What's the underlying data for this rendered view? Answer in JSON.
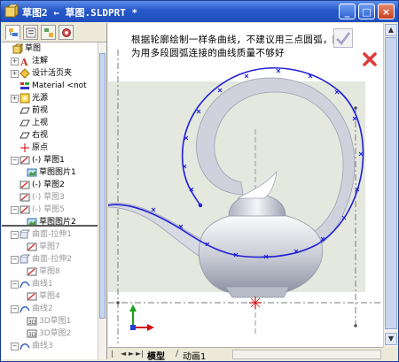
{
  "window": {
    "title": "草图2 ← 草图.SLDPRT *",
    "buttons": {
      "minimize": "_",
      "maximize": "□",
      "close": "×"
    }
  },
  "feature_tree": {
    "tabs": [
      "feature-manager",
      "property-manager",
      "configuration-manager",
      "display-manager"
    ],
    "items": [
      {
        "label": "草图",
        "icon": "part-icon",
        "indent": 0,
        "expander": "",
        "dim": false
      },
      {
        "label": "注解",
        "icon": "annotations-icon",
        "indent": 1,
        "expander": "+",
        "dim": false
      },
      {
        "label": "设计活页夹",
        "icon": "design-binder-icon",
        "indent": 1,
        "expander": "+",
        "dim": false
      },
      {
        "label": "Material <not",
        "icon": "material-icon",
        "indent": 1,
        "expander": "",
        "dim": false
      },
      {
        "label": "光源",
        "icon": "lights-icon",
        "indent": 1,
        "expander": "+",
        "dim": false
      },
      {
        "label": "前视",
        "icon": "plane-icon",
        "indent": 1,
        "expander": "",
        "dim": false
      },
      {
        "label": "上视",
        "icon": "plane-icon",
        "indent": 1,
        "expander": "",
        "dim": false
      },
      {
        "label": "右视",
        "icon": "plane-icon",
        "indent": 1,
        "expander": "",
        "dim": false
      },
      {
        "label": "原点",
        "icon": "origin-icon",
        "indent": 1,
        "expander": "",
        "dim": false
      },
      {
        "label": "(-) 草图1",
        "icon": "sketch-icon",
        "indent": 1,
        "expander": "−",
        "dim": false
      },
      {
        "label": "草图图片1",
        "icon": "sketch-picture-icon",
        "indent": 2,
        "expander": "",
        "dim": false
      },
      {
        "label": "(-) 草图2",
        "icon": "sketch-icon",
        "indent": 1,
        "expander": "",
        "dim": false
      },
      {
        "label": "(-) 草图3",
        "icon": "sketch-icon",
        "indent": 1,
        "expander": "",
        "dim": true
      },
      {
        "label": "(-) 草图5",
        "icon": "sketch-icon",
        "indent": 1,
        "expander": "−",
        "dim": true
      },
      {
        "label": "草图图片2",
        "icon": "sketch-picture-icon",
        "indent": 2,
        "expander": "",
        "dim": false
      },
      {
        "label": "曲面-拉伸1",
        "icon": "surface-extrude-icon",
        "indent": 1,
        "expander": "−",
        "dim": true
      },
      {
        "label": "草图7",
        "icon": "sketch-icon",
        "indent": 2,
        "expander": "",
        "dim": true
      },
      {
        "label": "曲面-拉伸2",
        "icon": "surface-extrude-icon",
        "indent": 1,
        "expander": "−",
        "dim": true
      },
      {
        "label": "草图8",
        "icon": "sketch-icon",
        "indent": 2,
        "expander": "",
        "dim": true
      },
      {
        "label": "曲线1",
        "icon": "curve-icon",
        "indent": 1,
        "expander": "−",
        "dim": true
      },
      {
        "label": "草图4",
        "icon": "sketch-icon",
        "indent": 2,
        "expander": "",
        "dim": true
      },
      {
        "label": "曲线2",
        "icon": "curve-icon",
        "indent": 1,
        "expander": "−",
        "dim": true
      },
      {
        "label": "3D草图1",
        "icon": "sketch-3d-icon",
        "indent": 2,
        "expander": "",
        "dim": true
      },
      {
        "label": "3D草图2",
        "icon": "sketch-3d-icon",
        "indent": 2,
        "expander": "",
        "dim": true
      },
      {
        "label": "曲线3",
        "icon": "curve-icon",
        "indent": 1,
        "expander": "−",
        "dim": true
      }
    ]
  },
  "canvas": {
    "note": "根据轮廓绘制一样条曲线，不建议用三点圆弧，因为用多段圆弧连接的曲线质量不够好",
    "confirm": {
      "ok": "check-icon",
      "cancel": "x-icon"
    },
    "colors": {
      "spline": "#1f1fd6",
      "sketch_line": "#7a7a7a",
      "picture_bg": "#e4e8df",
      "origin": "#d01010"
    }
  },
  "bottom_tabs": {
    "nav": [
      "|◄",
      "◄",
      "►",
      "►|"
    ],
    "tabs": [
      {
        "label": "模型",
        "active": true
      },
      {
        "label": "动画1",
        "active": false
      }
    ]
  }
}
